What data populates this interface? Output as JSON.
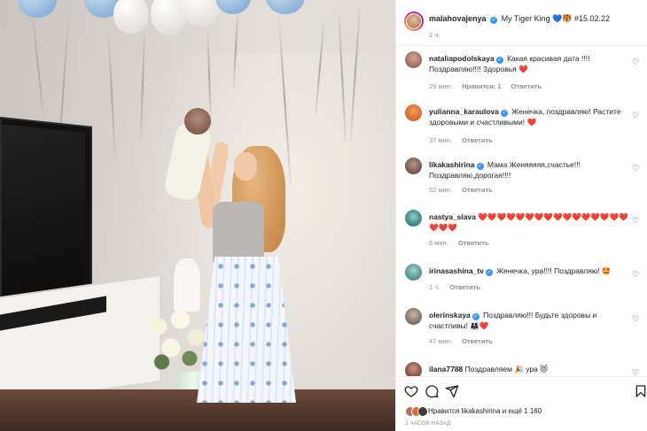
{
  "post": {
    "author": "malahovajenya",
    "caption": "My Tiger King 💙🐯 #15.02.22",
    "time": "2 ч."
  },
  "comments": [
    {
      "user": "nataliapodolskaya",
      "verified": true,
      "text": "Какая красивая дата !!!! Поздравляю!!!! Здоровья ❤️",
      "time": "29 мин.",
      "likes": "Нравится: 1",
      "reply": "Ответить",
      "avatar_color": "#a46a6a"
    },
    {
      "user": "yulianna_karaulova",
      "verified": true,
      "text": "Женечка, поздравляю! Растите здоровыми и счастливыми! ❤️",
      "time": "37 мин.",
      "likes": "",
      "reply": "Ответить",
      "avatar_color": "#e2702f"
    },
    {
      "user": "likakashirina",
      "verified": true,
      "text": "Мама Женяяяяя,счастье!!! Поздравляю,дорогая!!!!",
      "time": "52 мин.",
      "likes": "",
      "reply": "Ответить",
      "avatar_color": "#6b5346"
    },
    {
      "user": "nastya_slava",
      "verified": false,
      "text": "❤️❤️❤️❤️❤️❤️❤️❤️❤️❤️❤️❤️❤️❤️❤️❤️❤️❤️❤️",
      "time": "6 мин.",
      "likes": "",
      "reply": "Ответить",
      "avatar_color": "#3a8a88"
    },
    {
      "user": "irinasashina_tv",
      "verified": true,
      "text": "Женечка, ура!!!! Поздравляю! 🤩",
      "time": "1 ч.",
      "likes": "",
      "reply": "Ответить",
      "avatar_color": "#4d8f8c"
    },
    {
      "user": "olerinskaya",
      "verified": true,
      "text": "Поздравляю!!! Будьте здоровы и счастливы! 👨‍👩‍👧❤️",
      "time": "47 мин.",
      "likes": "",
      "reply": "Ответить",
      "avatar_color": "#8c7a6b"
    },
    {
      "user": "ilana7788",
      "verified": false,
      "text": "Поздравляем 🎉 ура 😻",
      "time": "",
      "likes": "",
      "reply": "",
      "avatar_color": "#7a4a3a"
    }
  ],
  "actions": {
    "like_icon": "heart-outline-icon",
    "comment_icon": "comment-icon",
    "share_icon": "paper-plane-icon",
    "save_icon": "bookmark-icon"
  },
  "likes_summary": {
    "text": "Нравится likakashirina и ещё 1 160",
    "avatar_colors": [
      "#b7715c",
      "#e06a38",
      "#4a3830"
    ]
  },
  "posted_ago": "2 ЧАСОВ НАЗАД",
  "colors": {
    "verified_blue": "#3897f0",
    "muted_text": "#8e8e8e",
    "heart_red": "#ed4956"
  }
}
